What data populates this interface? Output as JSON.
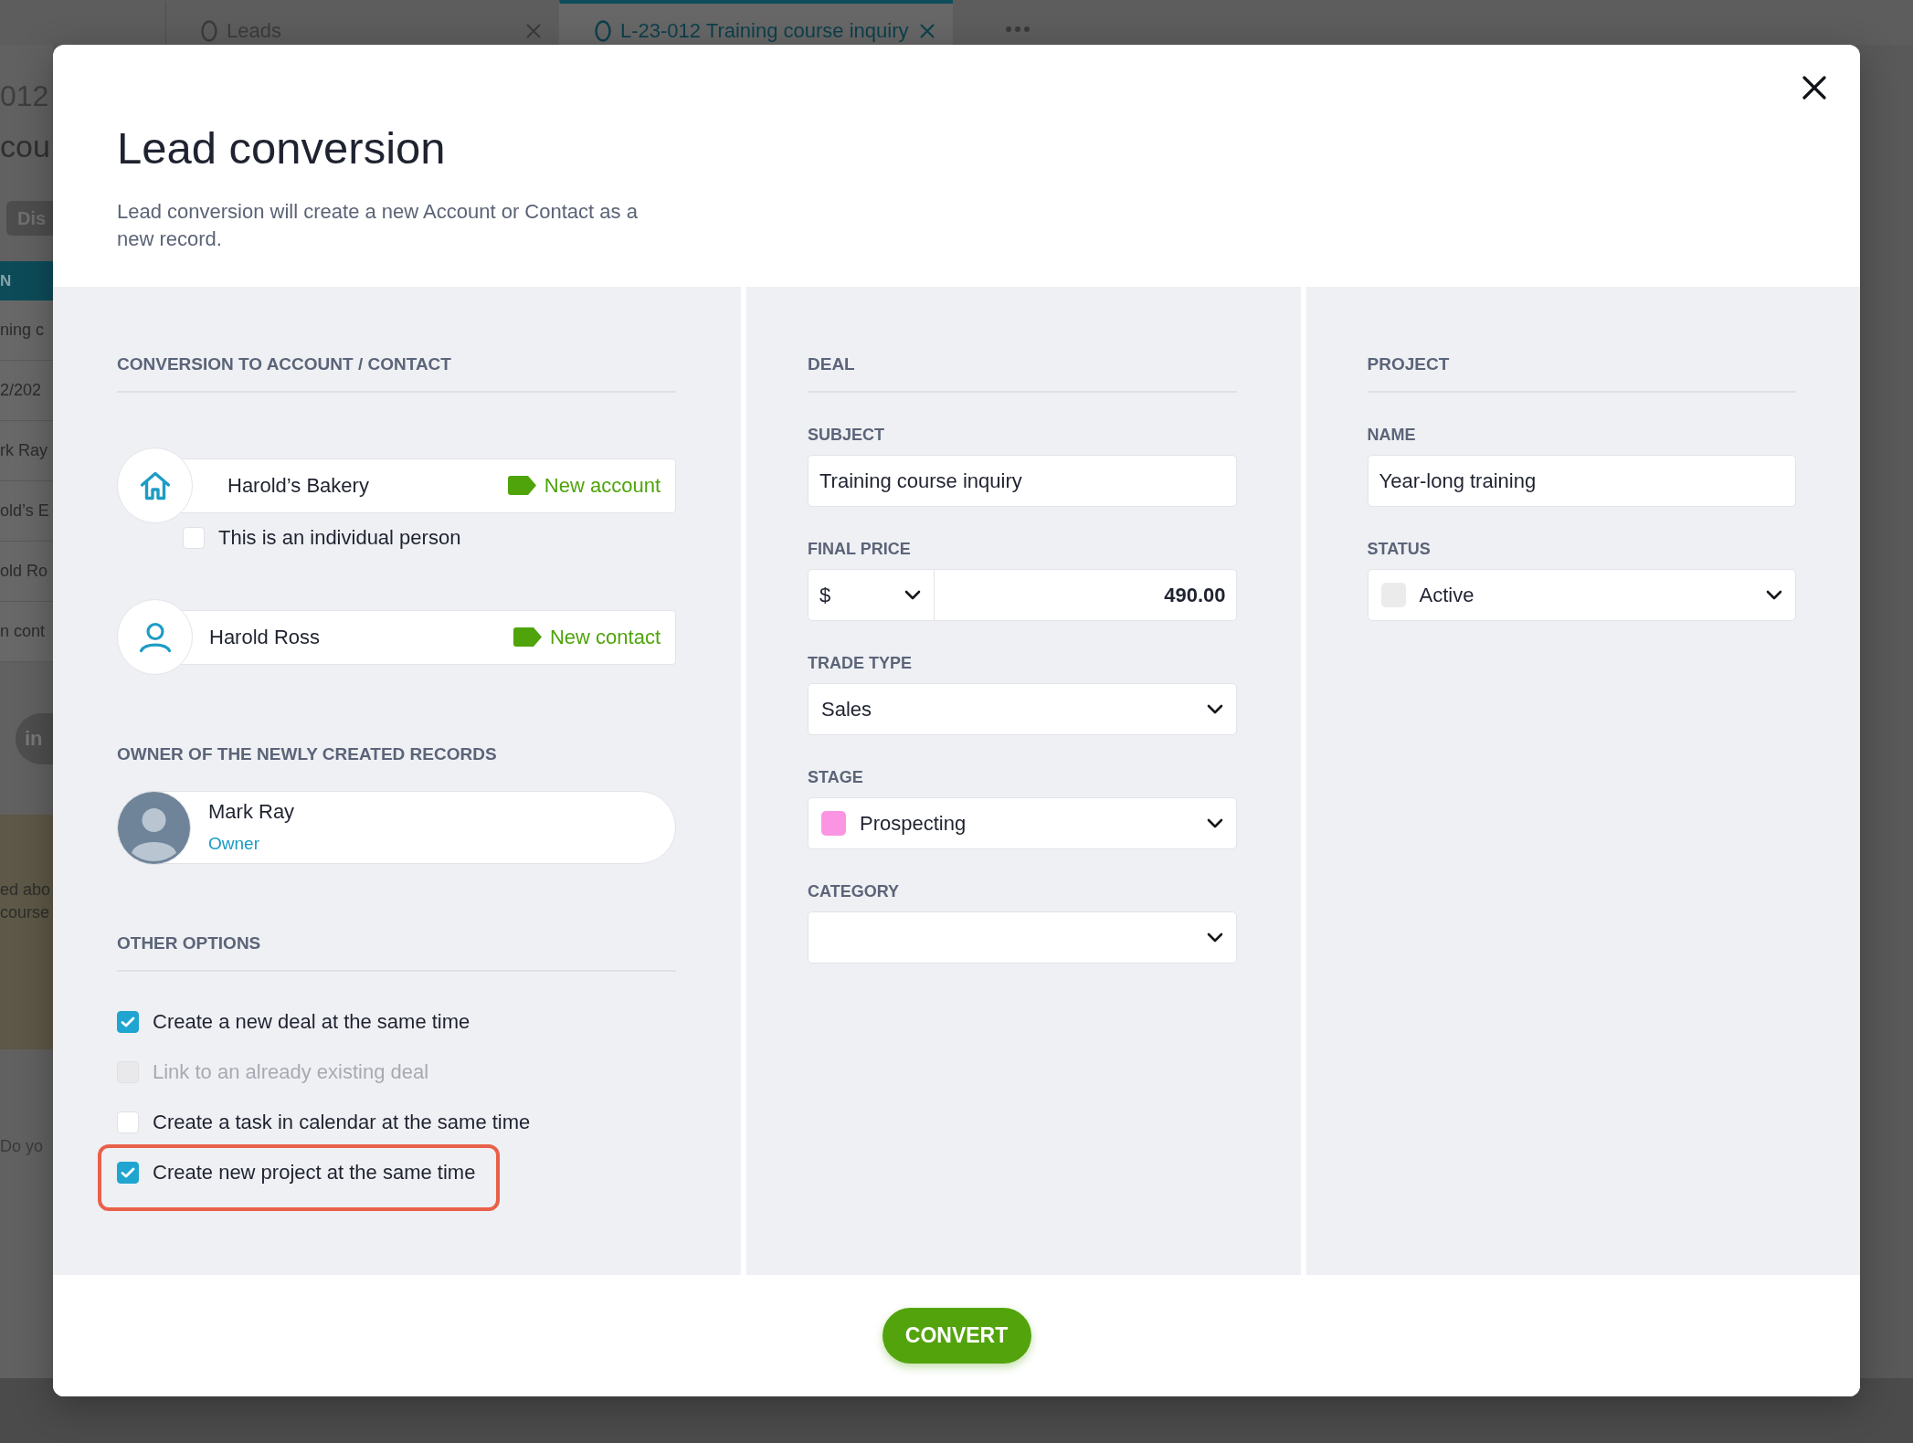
{
  "background_page": {
    "tabs": [
      {
        "label": "Leads",
        "selected": false
      },
      {
        "label": "L-23-012 Training course inquiry",
        "selected": true
      }
    ],
    "record_number": "012",
    "record_title": "cou",
    "action_button": "Dis",
    "table_header": "N",
    "rows": [
      "ning c",
      "2/202",
      "rk Ray",
      "old’s E",
      "old Ro",
      "n cont"
    ],
    "badge": "in",
    "note_lines": [
      "ed abo",
      "course"
    ],
    "prompt": "Do yo"
  },
  "dialog": {
    "title": "Lead conversion",
    "description": "Lead conversion will create a new Account or Contact as a new record.",
    "conversion": {
      "heading": "CONVERSION TO ACCOUNT / CONTACT",
      "entities": [
        {
          "kind": "account",
          "name": "Harold’s Bakery",
          "tag": "New account",
          "checkbox": {
            "label": "This is an individual person",
            "checked": false
          }
        },
        {
          "kind": "contact",
          "name": "Harold Ross",
          "tag": "New contact"
        }
      ]
    },
    "owner": {
      "heading": "OWNER OF THE NEWLY CREATED RECORDS",
      "name": "Mark Ray",
      "role": "Owner"
    },
    "other_options": {
      "heading": "OTHER OPTIONS",
      "options": [
        {
          "label": "Create a new deal at the same time",
          "checked": true,
          "disabled": false,
          "highlighted": false
        },
        {
          "label": "Link to an already existing deal",
          "checked": false,
          "disabled": true,
          "highlighted": false
        },
        {
          "label": "Create a task in calendar at the same time",
          "checked": false,
          "disabled": false,
          "highlighted": false
        },
        {
          "label": "Create new project at the same time",
          "checked": true,
          "disabled": false,
          "highlighted": true
        }
      ]
    },
    "deal": {
      "heading": "DEAL",
      "fields": [
        {
          "kind": "text",
          "label": "SUBJECT",
          "value": "Training course inquiry"
        },
        {
          "kind": "price",
          "label": "FINAL PRICE",
          "currency": "$",
          "value": "490.00"
        },
        {
          "kind": "select",
          "label": "TRADE TYPE",
          "value": "Sales"
        },
        {
          "kind": "select",
          "label": "STAGE",
          "value": "Prospecting",
          "color": "#fb95e3"
        },
        {
          "kind": "select",
          "label": "CATEGORY"
        }
      ]
    },
    "project": {
      "heading": "PROJECT",
      "fields": [
        {
          "kind": "text",
          "label": "NAME",
          "value": "Year-long training"
        },
        {
          "kind": "select",
          "label": "STATUS",
          "value": "Active",
          "color": "#ebebeb"
        }
      ]
    },
    "convert_button": "CONVERT"
  }
}
